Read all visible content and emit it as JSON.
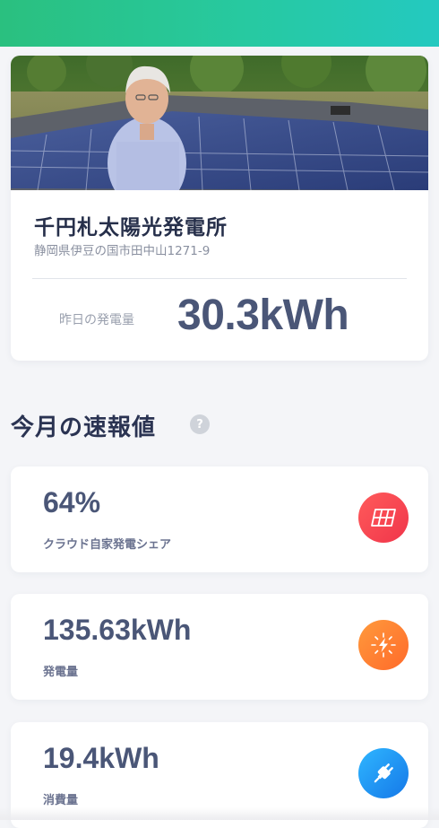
{
  "header": {
    "bar_color_start": "#2ac07f",
    "bar_color_end": "#24c9c0"
  },
  "plant": {
    "photo_icon": "plant-owner-photo",
    "name": "千円札太陽光発電所",
    "address": "静岡県伊豆の国市田中山1271-9",
    "yesterday_label": "昨日の発電量",
    "yesterday_value": "30.3kWh"
  },
  "monthly": {
    "title": "今月の速報値",
    "help_icon_glyph": "?",
    "help_icon": "question-mark-icon",
    "stats": [
      {
        "value": "64%",
        "label": "クラウド自家発電シェア",
        "icon": "solar-panel-icon",
        "icon_color": "#f0354a"
      },
      {
        "value": "135.63kWh",
        "label": "発電量",
        "icon": "lightning-sun-icon",
        "icon_color": "#ff6a2a"
      },
      {
        "value": "19.4kWh",
        "label": "消費量",
        "icon": "power-plug-icon",
        "icon_color": "#1578e8"
      }
    ]
  }
}
